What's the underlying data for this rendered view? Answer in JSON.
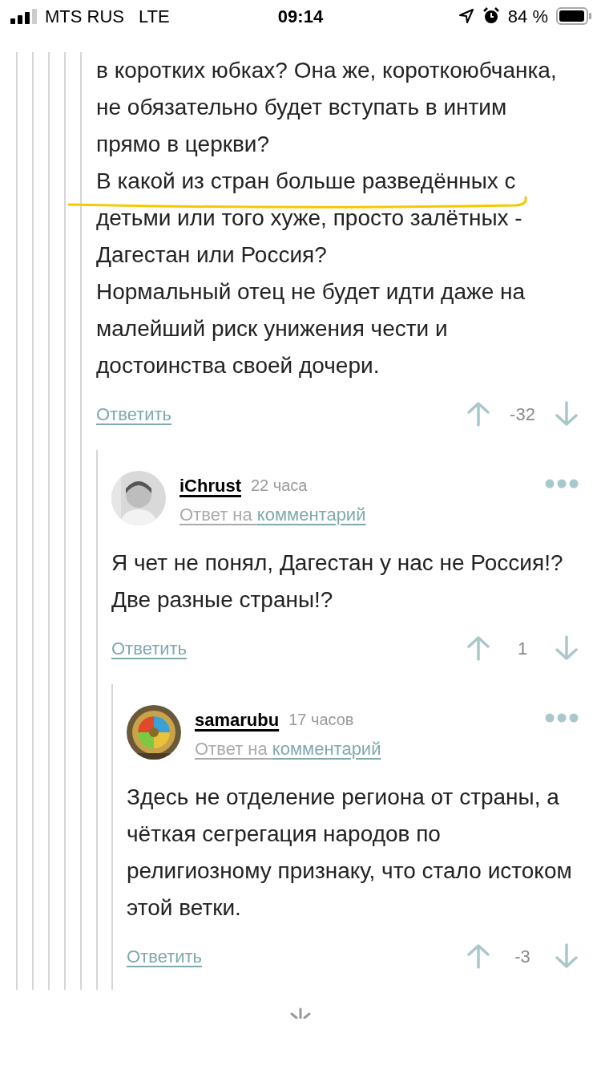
{
  "status_bar": {
    "carrier": "MTS RUS",
    "network": "LTE",
    "time": "09:14",
    "battery_percent": "84 %"
  },
  "comment": {
    "paragraphs": [
      "в коротких юбках? Она же, короткоюбчанка, не обязательно будет вступать в интим прямо в церкви?",
      "В какой из стран больше разведённых с детьми или того хуже, просто залётных - Дагестан или Россия?",
      "Нормальный отец не будет идти даже на малейший риск унижения чести и достоинства своей дочери."
    ],
    "reply_label": "Ответить",
    "score": "-32",
    "children": [
      {
        "author": "iChrust",
        "time": "22 часа",
        "reply_to_prefix": "Ответ на",
        "reply_to_link": "комментарий",
        "paragraphs": [
          "Я чет не понял, Дагестан у нас не Россия!? Две разные страны!?"
        ],
        "reply_label": "Ответить",
        "score": "1",
        "children": [
          {
            "author": "samarubu",
            "time": "17 часов",
            "reply_to_prefix": "Ответ на",
            "reply_to_link": "комментарий",
            "paragraphs": [
              "Здесь не отделение региона от страны, а чёткая сегрегация народов по религиозному признаку, что стало истоком этой ветки."
            ],
            "reply_label": "Ответить",
            "score": "-3"
          }
        ]
      }
    ]
  }
}
